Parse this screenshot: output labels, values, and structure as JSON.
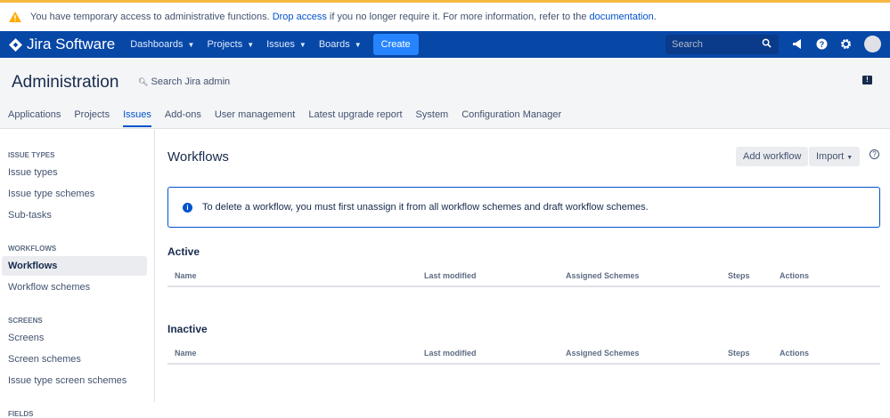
{
  "banner": {
    "text_before": "You have temporary access to administrative functions. ",
    "drop_access": "Drop access",
    "text_middle": " if you no longer require it. For more information, refer to the ",
    "documentation": "documentation",
    "text_after": "."
  },
  "nav": {
    "logo": "Jira Software",
    "items": [
      "Dashboards",
      "Projects",
      "Issues",
      "Boards"
    ],
    "create": "Create",
    "search_placeholder": "Search"
  },
  "admin": {
    "title": "Administration",
    "search": "Search Jira admin",
    "tabs": [
      "Applications",
      "Projects",
      "Issues",
      "Add-ons",
      "User management",
      "Latest upgrade report",
      "System",
      "Configuration Manager"
    ],
    "active_tab": "Issues"
  },
  "sidebar": {
    "issue_types": {
      "heading": "ISSUE TYPES",
      "items": [
        "Issue types",
        "Issue type schemes",
        "Sub-tasks"
      ]
    },
    "workflows": {
      "heading": "WORKFLOWS",
      "items": [
        "Workflows",
        "Workflow schemes"
      ]
    },
    "screens": {
      "heading": "SCREENS",
      "items": [
        "Screens",
        "Screen schemes",
        "Issue type screen schemes"
      ]
    },
    "fields": {
      "heading": "FIELDS"
    }
  },
  "main": {
    "title": "Workflows",
    "add_workflow": "Add workflow",
    "import": "Import",
    "info": "To delete a workflow, you must first unassign it from all workflow schemes and draft workflow schemes.",
    "active": "Active",
    "inactive": "Inactive",
    "columns": [
      "Name",
      "Last modified",
      "Assigned Schemes",
      "Steps",
      "Actions"
    ]
  }
}
